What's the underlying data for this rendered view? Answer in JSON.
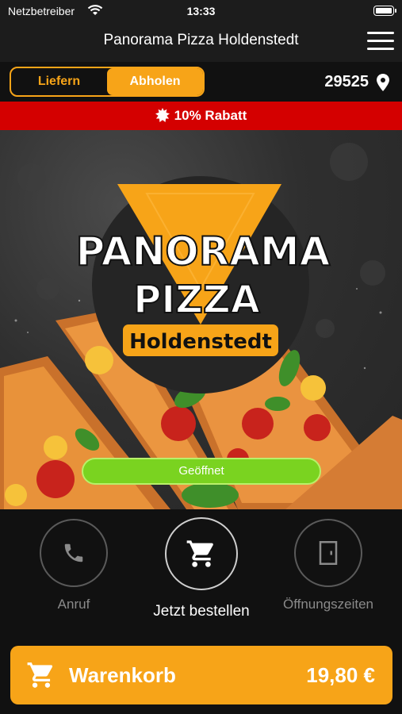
{
  "status_bar": {
    "carrier": "Netzbetreiber",
    "time": "13:33"
  },
  "nav": {
    "title": "Panorama Pizza Holdenstedt"
  },
  "mode_toggle": {
    "deliver_label": "Liefern",
    "pickup_label": "Abholen",
    "selected": "Abholen"
  },
  "location": {
    "postcode": "29525"
  },
  "promo": {
    "text": "10% Rabatt"
  },
  "logo": {
    "line1": "PANORAMA",
    "line2": "PIZZA",
    "badge": "Holdenstedt"
  },
  "hero": {
    "status_button": "Geöffnet"
  },
  "actions": {
    "call_label": "Anruf",
    "order_label": "Jetzt bestellen",
    "hours_label": "Öffnungszeiten"
  },
  "cart": {
    "label": "Warenkorb",
    "total": "19,80 €"
  },
  "colors": {
    "accent": "#f7a418",
    "promo": "#d40000",
    "open": "#7ad320",
    "background": "#111111"
  },
  "icons": {
    "wifi": "wifi-icon",
    "battery": "battery-icon",
    "menu": "hamburger-menu-icon",
    "location": "location-pin-icon",
    "promo": "starburst-icon",
    "call": "phone-icon",
    "order": "shopping-cart-icon",
    "hours": "door-icon",
    "cart": "shopping-cart-icon"
  }
}
